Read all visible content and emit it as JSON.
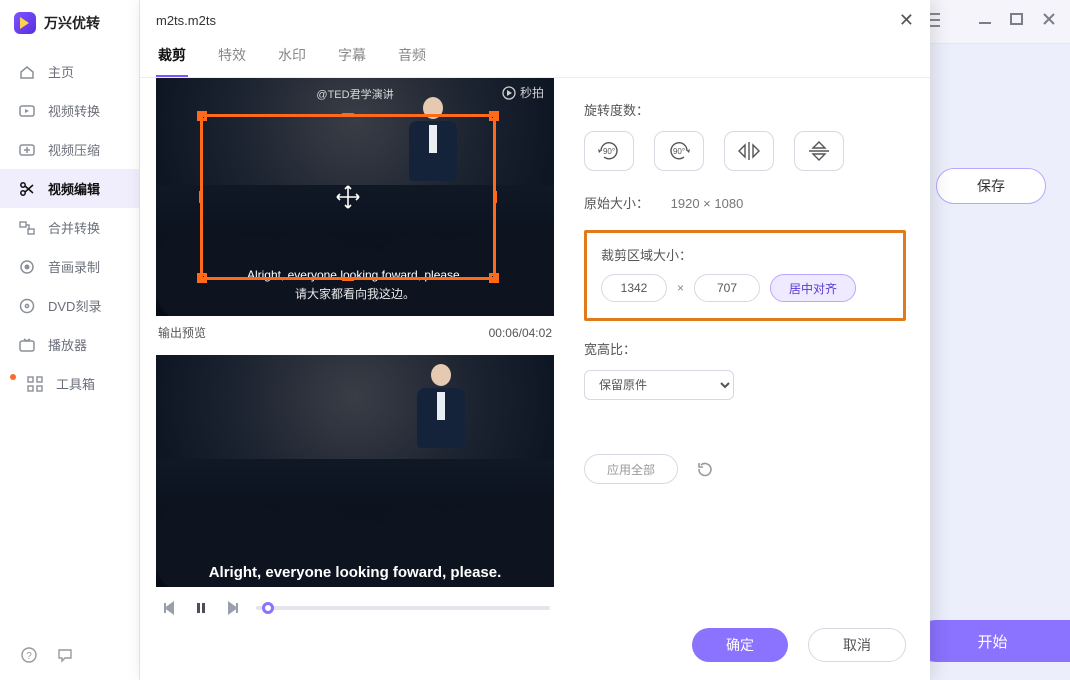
{
  "app": {
    "name": "万兴优转"
  },
  "sidebar": {
    "items": [
      {
        "label": "主页"
      },
      {
        "label": "视频转换"
      },
      {
        "label": "视频压缩"
      },
      {
        "label": "视频编辑"
      },
      {
        "label": "合并转换"
      },
      {
        "label": "音画录制"
      },
      {
        "label": "DVD刻录"
      },
      {
        "label": "播放器"
      },
      {
        "label": "工具箱"
      }
    ]
  },
  "background": {
    "save_label": "保存",
    "start_label": "开始"
  },
  "modal": {
    "filename": "m2ts.m2ts",
    "tabs": [
      {
        "label": "裁剪"
      },
      {
        "label": "特效"
      },
      {
        "label": "水印"
      },
      {
        "label": "字幕"
      },
      {
        "label": "音频"
      }
    ],
    "video_overlay": {
      "watermark_left": "@TED君学演讲",
      "watermark_right": "秒拍",
      "subtitle_en": "Alright, everyone looking foward, please.",
      "subtitle_zh": "请大家都看向我这边。"
    },
    "preview_label": "输出预览",
    "time": "00:06/04:02",
    "rotate_label": "旋转度数：",
    "rotate_options": [
      "90°↻",
      "90°↺",
      "⇋",
      "⇵"
    ],
    "orig_label": "原始大小：",
    "orig_value": "1920 × 1080",
    "crop_label": "裁剪区域大小：",
    "crop_w": "1342",
    "crop_h": "707",
    "center_label": "居中对齐",
    "aspect_label": "宽高比：",
    "aspect_value": "保留原件",
    "apply_all_label": "应用全部",
    "ok_label": "确定",
    "cancel_label": "取消"
  }
}
